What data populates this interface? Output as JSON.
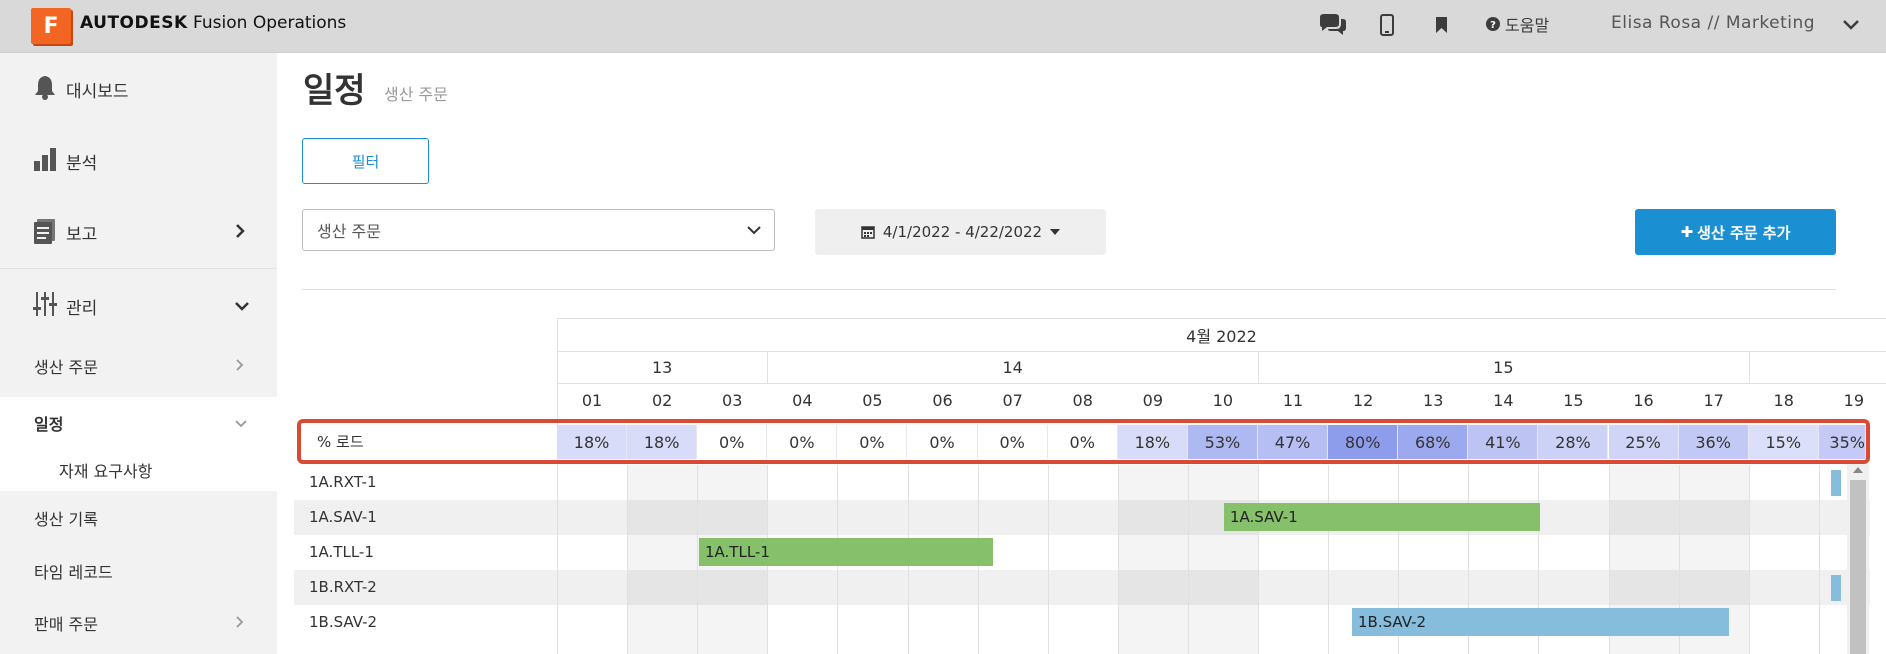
{
  "topbar": {
    "logo_letter": "F",
    "brand_bold": "AUTODESK",
    "brand_rest": "Fusion Operations",
    "help_label": "도움말",
    "user": "Elisa Rosa // Marketing",
    "icons": [
      "chat-icon",
      "mobile-icon",
      "bookmark-icon",
      "question-circle-icon",
      "chevron-down-icon"
    ]
  },
  "sidebar": {
    "items": [
      {
        "label": "대시보드",
        "icon": "bell-icon"
      },
      {
        "label": "분석",
        "icon": "bar-chart-icon"
      },
      {
        "label": "보고",
        "icon": "document-icon"
      },
      {
        "label": "관리",
        "icon": "sliders-icon"
      }
    ],
    "sub_items": [
      {
        "label": "생산 주문"
      },
      {
        "label": "일정"
      },
      {
        "label": "자재 요구사항"
      },
      {
        "label": "생산 기록"
      },
      {
        "label": "타임 레코드"
      },
      {
        "label": "판매 주문"
      }
    ]
  },
  "main": {
    "title": "일정",
    "subtitle": "생산 주문",
    "filter_label": "필터",
    "select_value": "생산 주문",
    "date_range": "4/1/2022 - 4/22/2022",
    "add_label": "생산 주문 추가"
  },
  "gantt": {
    "month": "4월 2022",
    "weeks": [
      "13",
      "14",
      "15"
    ],
    "days": [
      "01",
      "02",
      "03",
      "04",
      "05",
      "06",
      "07",
      "08",
      "09",
      "10",
      "11",
      "12",
      "13",
      "14",
      "15",
      "16",
      "17",
      "18",
      "19"
    ],
    "load_label": "% 로드",
    "load_values": [
      "18%",
      "18%",
      "0%",
      "0%",
      "0%",
      "0%",
      "0%",
      "0%",
      "18%",
      "53%",
      "47%",
      "80%",
      "68%",
      "41%",
      "28%",
      "25%",
      "36%",
      "15%",
      "35%"
    ],
    "load_levels": [
      18,
      18,
      0,
      0,
      0,
      0,
      0,
      0,
      18,
      53,
      47,
      80,
      68,
      41,
      28,
      25,
      36,
      15,
      35
    ],
    "rows": [
      "1A.RXT-1",
      "1A.SAV-1",
      "1A.TLL-1",
      "1B.RXT-2",
      "1B.SAV-2"
    ],
    "bars": [
      {
        "row": 1,
        "label": "1A.SAV-1",
        "color": "#86c06a"
      },
      {
        "row": 2,
        "label": "1A.TLL-1",
        "color": "#86c06a"
      },
      {
        "row": 4,
        "label": "1B.SAV-2",
        "color": "#86bddd"
      }
    ]
  },
  "colors": {
    "accent": "#1a8fd1",
    "highlight": "#d94a35",
    "bar_green": "#86c06a",
    "bar_blue": "#86bddd",
    "logo": "#f26522"
  }
}
